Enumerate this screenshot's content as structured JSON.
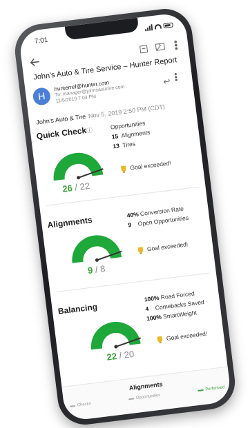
{
  "status": {
    "time": "7:01"
  },
  "email": {
    "subject": "John's Auto & Tire Service – Hunter Report",
    "avatar_letter": "H",
    "from_address": "hunterref@hunter.com",
    "to_line": "To: manager@johnsautotire.com",
    "date_line": "11/5/2019 7:04 PM",
    "shop_name": "John's Auto & Tire",
    "report_date": "Nov 5, 2019 2:50 PM (CDT)"
  },
  "quick_check": {
    "title": "Quick Check",
    "gauge_value": "26",
    "gauge_target": "22",
    "gauge_fraction": 1.0,
    "opps_header": "Opportunities",
    "stats": [
      {
        "num": "15",
        "label": "Alignments"
      },
      {
        "num": "13",
        "label": "Tires"
      }
    ],
    "goal_text": "Goal exceeded!"
  },
  "alignments": {
    "title": "Alignments",
    "gauge_value": "9",
    "gauge_target": "8",
    "gauge_fraction": 1.0,
    "stats": [
      {
        "num": "40%",
        "label": "Conversion Rate"
      },
      {
        "num": "9",
        "label": "Open Opportunities"
      }
    ],
    "goal_text": "Goal exceeded!"
  },
  "balancing": {
    "title": "Balancing",
    "gauge_value": "22",
    "gauge_target": "20",
    "gauge_fraction": 1.0,
    "stats": [
      {
        "num": "100%",
        "label": "Road Forced"
      },
      {
        "num": "4",
        "label": "Comebacks Saved"
      },
      {
        "num": "100%",
        "label": "SmartWeight"
      }
    ],
    "goal_text": "Goal exceeded!"
  },
  "bottom": {
    "title": "Alignments",
    "legend": [
      "Checks",
      "Opportunities",
      "Performed"
    ]
  },
  "colors": {
    "gauge_green": "#1fa83a",
    "accent_blue": "#4a7fd6",
    "trophy": "#e8b928"
  }
}
